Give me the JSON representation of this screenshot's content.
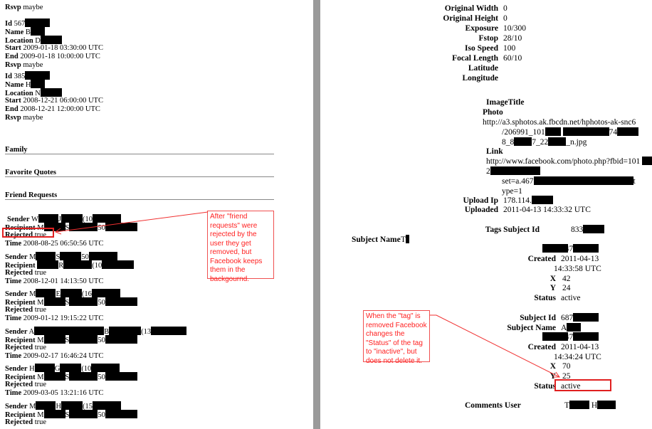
{
  "left": {
    "top_rsvp": {
      "label": "Rsvp",
      "value": "maybe"
    },
    "events": [
      {
        "id": "567",
        "name": "B",
        "location": "D",
        "start": "2009-01-18 03:30:00 UTC",
        "end": "2009-01-18 10:00:00 UTC",
        "rsvp": "maybe"
      },
      {
        "id": "385",
        "name": "H",
        "location": "N",
        "start": "2008-12-21 06:00:00 UTC",
        "end": "2008-12-21 12:00:00 UTC",
        "rsvp": "maybe"
      }
    ],
    "labels": {
      "id": "Id",
      "name": "Name",
      "location": "Location",
      "start": "Start",
      "end": "End",
      "rsvp": "Rsvp",
      "sender": "Sender",
      "recipient": "Recipient",
      "rejected": "Rejected",
      "time": "Time"
    },
    "sections": [
      "Family",
      "Favorite Quotes",
      "Friend Requests"
    ],
    "friend_requests": [
      {
        "sender": [
          "W",
          "J",
          "(10",
          ""
        ],
        "recipient": [
          "M",
          "S",
          "50",
          ""
        ],
        "rejected": "true",
        "time": "2008-08-25 06:50:56 UTC"
      },
      {
        "sender": [
          "M",
          "S",
          "50",
          ""
        ],
        "recipient": [
          "",
          "R",
          "(10",
          ""
        ],
        "rejected": "true",
        "time": "2008-12-01 14:13:50 UTC"
      },
      {
        "sender": [
          "M",
          "E",
          "(16",
          ""
        ],
        "recipient": [
          "M",
          "S",
          "50",
          ""
        ],
        "rejected": "true",
        "time": "2009-01-12 19:15:22 UTC"
      },
      {
        "sender": [
          "A",
          "",
          "",
          "B",
          "(13",
          ""
        ],
        "recipient": [
          "M",
          "S",
          "50",
          ""
        ],
        "rejected": "true",
        "time": "2009-02-17 16:46:24 UTC"
      },
      {
        "sender": [
          "H",
          "G",
          "(10",
          ""
        ],
        "recipient": [
          "M",
          "S",
          "50",
          ""
        ],
        "rejected": "true",
        "time": "2009-03-05 13:21:16 UTC"
      },
      {
        "sender": [
          "M",
          "H",
          "(15",
          ""
        ],
        "recipient": [
          "M",
          "S",
          "50",
          ""
        ],
        "rejected": "true",
        "time": ""
      }
    ],
    "annotation": "After \"friend requests\" were rejected by the user they get removed, but Facebook keeps them in the backgournd."
  },
  "right": {
    "photo_meta": [
      {
        "label": "Original Width",
        "value": "0"
      },
      {
        "label": "Original Height",
        "value": "0"
      },
      {
        "label": "Exposure",
        "value": "10/300"
      },
      {
        "label": "Fstop",
        "value": "28/10"
      },
      {
        "label": "Iso Speed",
        "value": "100"
      },
      {
        "label": "Focal Length",
        "value": "60/10"
      },
      {
        "label": "Latitude",
        "value": ""
      },
      {
        "label": "Longitude",
        "value": ""
      }
    ],
    "image_title_label": "ImageTitle",
    "photo_label": "Photo",
    "photo_url": [
      "http://a3.sphotos.ak.fbcdn.net/hphotos-ak-snc6",
      "/206991_101",
      "74",
      "8_8",
      "7_22",
      "_n.jpg"
    ],
    "link_label": "Link",
    "link_url": [
      "http://www.facebook.com/photo.php?fbid=101",
      "2",
      "set=a.467",
      "t",
      "ype=1"
    ],
    "upload_ip": {
      "label": "Upload Ip",
      "value": "178.114."
    },
    "uploaded": {
      "label": "Uploaded",
      "value": "2011-04-13 14:33:32 UTC"
    },
    "tags_subject_id": {
      "label": "Tags Subject Id",
      "value": "833"
    },
    "subject_name_1": {
      "label": "Subject Name",
      "value": "T"
    },
    "tag1": {
      "id_label": "Id",
      "id": "747",
      "created_label": "Created",
      "created_date": "2011-04-13",
      "created_time": "14:33:58 UTC",
      "x_label": "X",
      "x": "42",
      "y_label": "Y",
      "y": "24",
      "status_label": "Status",
      "status": "active"
    },
    "tag2": {
      "subject_id_label": "Subject Id",
      "subject_id": "687",
      "subject_name_label": "Subject Name",
      "subject_name": "A",
      "id_label": "Id",
      "id": "747",
      "created_label": "Created",
      "created_date": "2011-04-13",
      "created_time": "14:34:24 UTC",
      "x_label": "X",
      "x": "70",
      "y_label": "Y",
      "y": "25",
      "status_label": "Status",
      "status": "active"
    },
    "comments_user": {
      "label": "Comments User",
      "value": [
        "T",
        "H"
      ]
    },
    "annotation": "When the \"tag\" is removed Facebook changes the \"Status\" of the tag to \"inactive\", but does not delete it."
  },
  "colors": {
    "annotation": "#ff2020",
    "highlight": "#e02020",
    "redaction": "#000000",
    "gutter": "#9a9a9a"
  }
}
